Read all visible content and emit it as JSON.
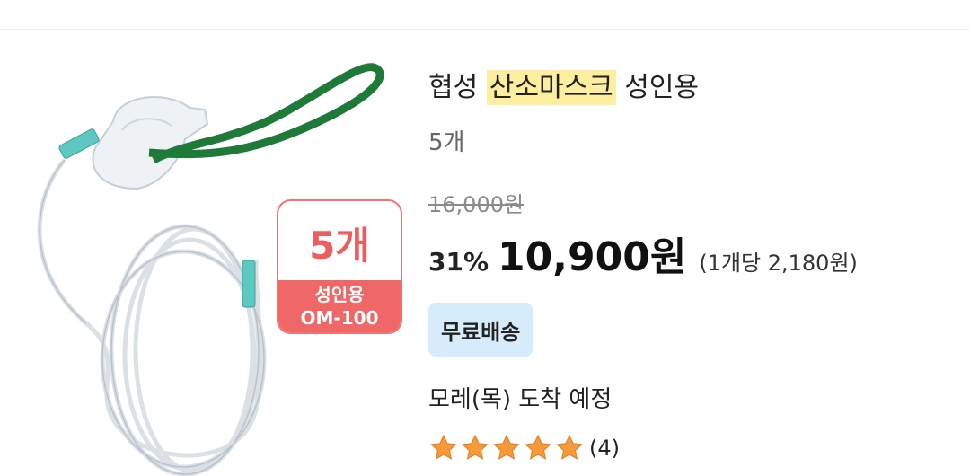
{
  "product": {
    "title_prefix": "협성",
    "title_highlight": "산소마스크",
    "title_suffix": "성인용",
    "quantity": "5개",
    "original_price": "16,000원",
    "discount": "31%",
    "price": "10,900원",
    "unit_price": "(1개당 2,180원)",
    "shipping_badge": "무료배송",
    "delivery": "모레(목) 도착 예정",
    "rating": 5,
    "review_count": "(4)"
  },
  "image_badge": {
    "quantity": "5개",
    "line1": "성인용",
    "line2": "OM-100"
  },
  "colors": {
    "highlight": "#fdeea0",
    "badge_red": "#f06767",
    "shipping_bg": "#d7ecfb",
    "star": "#f59a3b",
    "strap": "#1f7a3a"
  }
}
